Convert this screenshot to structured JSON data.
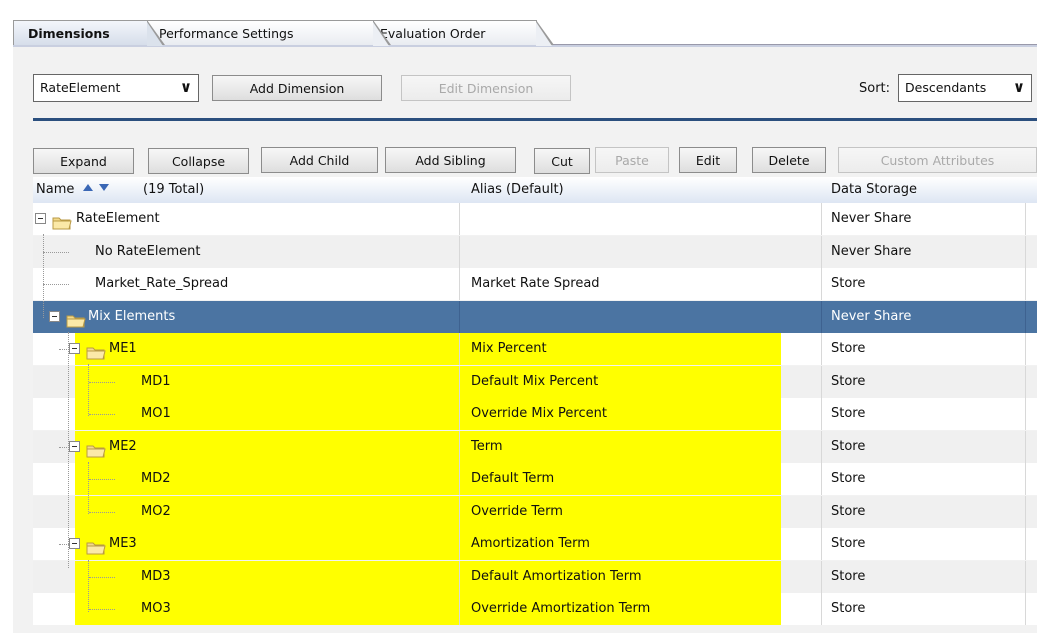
{
  "tabs": [
    "Dimensions",
    "Performance Settings",
    "Evaluation Order"
  ],
  "toolbar1": {
    "dimension_select": "RateElement",
    "add_dimension": "Add Dimension",
    "edit_dimension": "Edit Dimension",
    "sort_label": "Sort:",
    "sort_value": "Descendants"
  },
  "toolbar2": {
    "expand": "Expand",
    "collapse": "Collapse",
    "add_child": "Add Child",
    "add_sibling": "Add Sibling",
    "cut": "Cut",
    "paste": "Paste",
    "edit": "Edit",
    "delete": "Delete",
    "custom_attributes": "Custom Attributes"
  },
  "grid": {
    "columns": {
      "name": "Name",
      "total": "(19 Total)",
      "alias": "Alias  (Default)",
      "storage": "Data Storage"
    },
    "rows": [
      {
        "name": "RateElement",
        "alias": "",
        "storage": "Never Share"
      },
      {
        "name": "No RateElement",
        "alias": "",
        "storage": "Never Share"
      },
      {
        "name": "Market_Rate_Spread",
        "alias": "Market Rate Spread",
        "storage": "Store"
      },
      {
        "name": "Mix Elements",
        "alias": "",
        "storage": "Never Share"
      },
      {
        "name": "ME1",
        "alias": "Mix Percent",
        "storage": "Store"
      },
      {
        "name": "MD1",
        "alias": "Default Mix Percent",
        "storage": "Store"
      },
      {
        "name": "MO1",
        "alias": "Override Mix Percent",
        "storage": "Store"
      },
      {
        "name": "ME2",
        "alias": "Term",
        "storage": "Store"
      },
      {
        "name": "MD2",
        "alias": "Default Term",
        "storage": "Store"
      },
      {
        "name": "MO2",
        "alias": "Override Term",
        "storage": "Store"
      },
      {
        "name": "ME3",
        "alias": "Amortization Term",
        "storage": "Store"
      },
      {
        "name": "MD3",
        "alias": "Default Amortization Term",
        "storage": "Store"
      },
      {
        "name": "MO3",
        "alias": "Override Amortization Term",
        "storage": "Store"
      }
    ]
  },
  "colors": {
    "selected_row": "#4b74a2",
    "highlight": "#ffff00",
    "rule": "#2b4f7e"
  }
}
